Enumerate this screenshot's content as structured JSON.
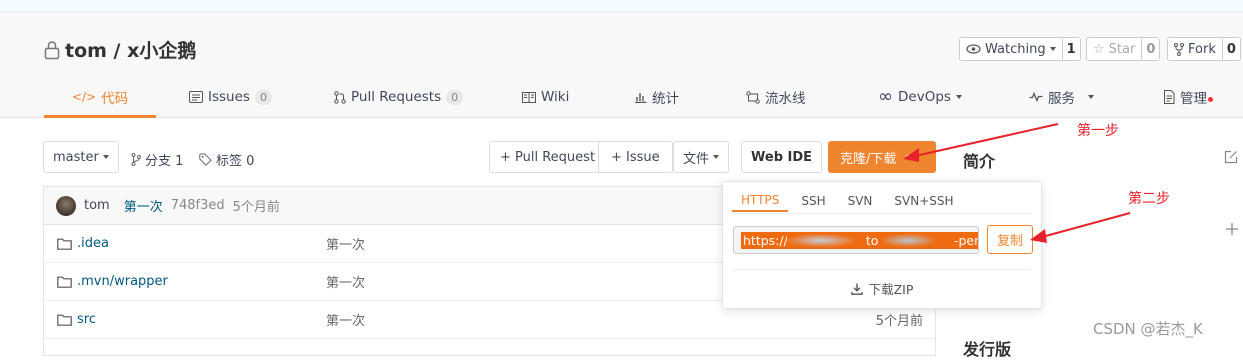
{
  "repo": {
    "title": "tom / x小企鹅"
  },
  "header_actions": {
    "watching": {
      "label": "Watching",
      "count": "1"
    },
    "star": {
      "label": "Star",
      "count": "0"
    },
    "fork": {
      "label": "Fork",
      "count": "0"
    }
  },
  "nav": {
    "code": "代码",
    "issues": "Issues",
    "issues_count": "0",
    "pull_requests": "Pull Requests",
    "pull_requests_count": "0",
    "wiki": "Wiki",
    "stats": "统计",
    "pipeline": "流水线",
    "devops": "DevOps",
    "services": "服务",
    "manage": "管理"
  },
  "toolbar": {
    "branch": "master",
    "branches": "分支 1",
    "tags": "标签 0",
    "pull_request": "+ Pull Request",
    "issue": "+ Issue",
    "file": "文件",
    "web_ide": "Web IDE",
    "clone": "克隆/下载"
  },
  "commit": {
    "author": "tom",
    "message": "第一次",
    "hash": "748f3ed",
    "time": "5个月前"
  },
  "files": [
    {
      "name": ".idea",
      "message": "第一次",
      "time": ""
    },
    {
      "name": ".mvn/wrapper",
      "message": "第一次",
      "time": ""
    },
    {
      "name": "src",
      "message": "第一次",
      "time": "5个月前"
    }
  ],
  "clone_popup": {
    "tabs": [
      "HTTPS",
      "SSH",
      "SVN",
      "SVN+SSH"
    ],
    "active_tab": "HTTPS",
    "url_start": "https://",
    "url_mid": "to",
    "url_mid2": "/x",
    "url_end": "-pengu",
    "copy": "复制",
    "download_zip": "下载ZIP"
  },
  "annotations": {
    "step1": "第一步",
    "step2": "第二步",
    "color": "#e8222a"
  },
  "sidebar": {
    "intro": "简介",
    "releases": "发行版"
  },
  "watermark": "CSDN @若杰_K",
  "colors": {
    "accent": "#f0852f",
    "link": "#005980"
  }
}
